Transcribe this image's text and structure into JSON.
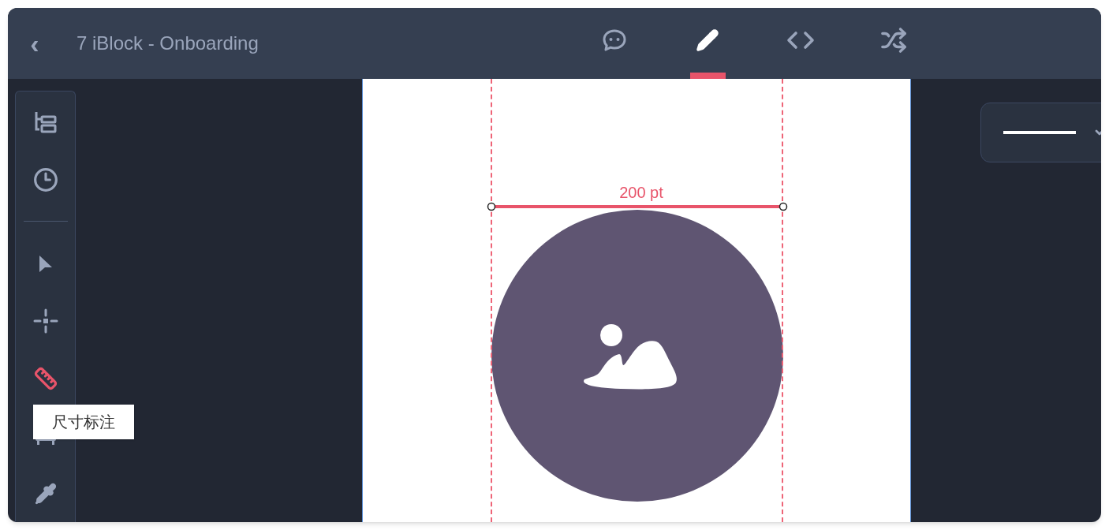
{
  "header": {
    "back": "‹",
    "title": "7 iBlock - Onboarding"
  },
  "tabs": [
    {
      "kind": "comment",
      "selected": false
    },
    {
      "kind": "edit",
      "selected": true
    },
    {
      "kind": "code",
      "selected": false
    },
    {
      "kind": "shuffle",
      "selected": false
    }
  ],
  "tools": [
    {
      "kind": "layers",
      "selected": false
    },
    {
      "kind": "history",
      "selected": false
    },
    {
      "kind": "divider"
    },
    {
      "kind": "pointer",
      "selected": false
    },
    {
      "kind": "crosshair",
      "selected": false
    },
    {
      "kind": "ruler",
      "selected": true
    },
    {
      "kind": "component",
      "selected": false
    },
    {
      "kind": "eyedropper",
      "selected": false
    }
  ],
  "tooltip": "尺寸标注",
  "canvas": {
    "measurement": "200 pt"
  },
  "stroke_dropdown": {
    "expanded": false
  }
}
